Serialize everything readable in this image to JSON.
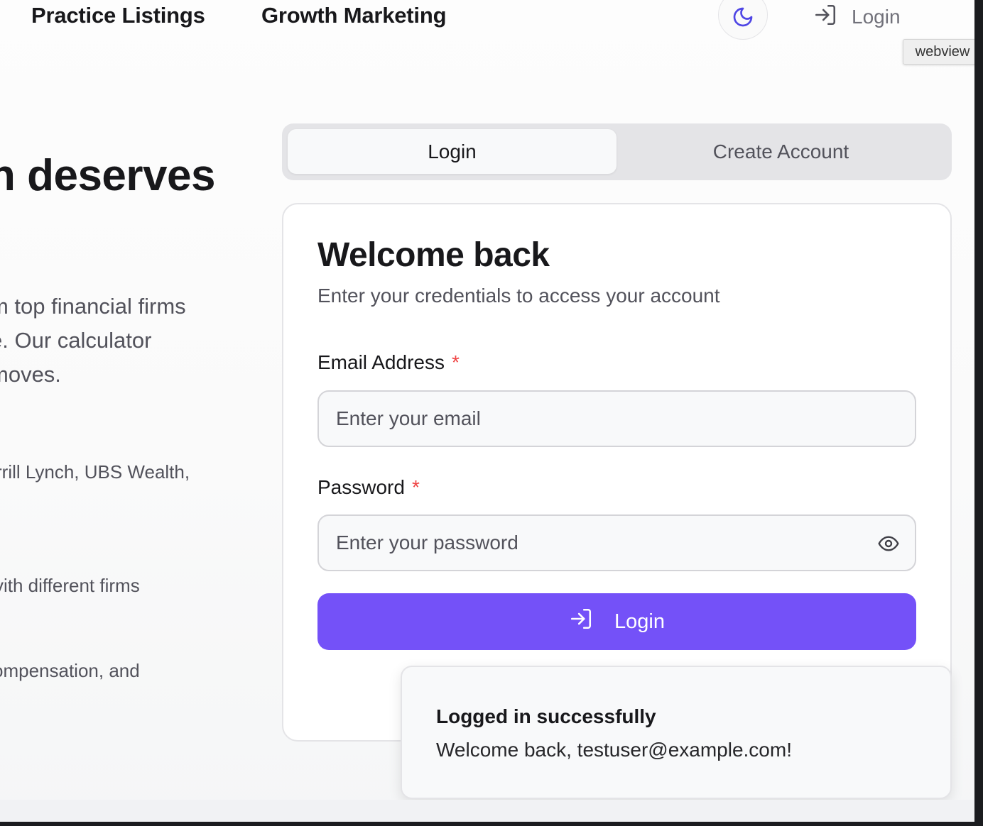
{
  "nav": {
    "links": [
      "Practice Listings",
      "Growth Marketing"
    ],
    "theme_icon": "moon-icon",
    "login_label": "Login",
    "login_icon": "login-arrow-icon"
  },
  "tooltip": "webview",
  "hero": {
    "heading": "n deserves",
    "paragraph_lines": [
      "m top financial firms",
      "e. Our calculator",
      "moves."
    ],
    "bullets": [
      "rrill Lynch, UBS Wealth,",
      "vith different firms",
      "ompensation, and"
    ]
  },
  "tabs": [
    {
      "label": "Login",
      "active": true
    },
    {
      "label": "Create Account",
      "active": false
    }
  ],
  "card": {
    "title": "Welcome back",
    "subtitle": "Enter your credentials to access your account",
    "email": {
      "label": "Email Address",
      "required_mark": "*",
      "placeholder": "Enter your email",
      "value": ""
    },
    "password": {
      "label": "Password",
      "required_mark": "*",
      "placeholder": "Enter your password",
      "value": "",
      "toggle_icon": "eye-icon"
    },
    "submit_label": "Login",
    "submit_icon": "login-arrow-icon"
  },
  "toast": {
    "title": "Logged in successfully",
    "message": "Welcome back, testuser@example.com!"
  },
  "colors": {
    "accent": "#7451f8",
    "required": "#ef4444",
    "text_primary": "#18181b",
    "text_muted": "#52525b",
    "moon_icon": "#4f46e5"
  }
}
